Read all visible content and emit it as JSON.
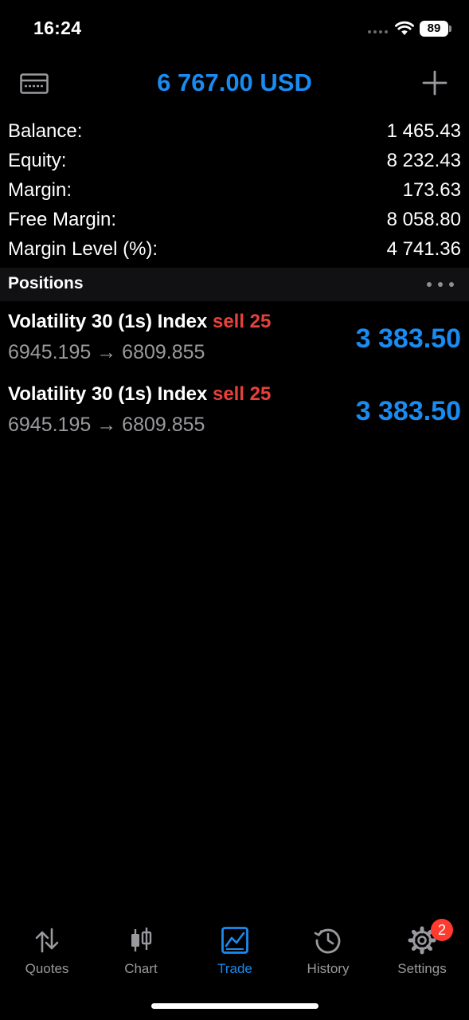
{
  "status_bar": {
    "time": "16:24",
    "battery": "89"
  },
  "header": {
    "title": "6 767.00 USD"
  },
  "account": [
    {
      "label": "Balance:",
      "value": "1 465.43"
    },
    {
      "label": "Equity:",
      "value": "8 232.43"
    },
    {
      "label": "Margin:",
      "value": "173.63"
    },
    {
      "label": "Free Margin:",
      "value": "8 058.80"
    },
    {
      "label": "Margin Level (%):",
      "value": "4 741.36"
    }
  ],
  "positions": {
    "title": "Positions",
    "items": [
      {
        "symbol": "Volatility 30 (1s) Index",
        "side": "sell 25",
        "prices": "6945.195 → 6809.855",
        "profit": "3 383.50"
      },
      {
        "symbol": "Volatility 30 (1s) Index",
        "side": "sell 25",
        "prices": "6945.195 → 6809.855",
        "profit": "3 383.50"
      }
    ]
  },
  "tabs": [
    {
      "label": "Quotes",
      "icon": "quotes-arrows-icon"
    },
    {
      "label": "Chart",
      "icon": "candlestick-icon"
    },
    {
      "label": "Trade",
      "icon": "trade-chart-icon",
      "active": true
    },
    {
      "label": "History",
      "icon": "history-clock-icon"
    },
    {
      "label": "Settings",
      "icon": "gear-icon",
      "badge": "2"
    }
  ],
  "colors": {
    "accent": "#1a8bf0",
    "sell": "#e8413c",
    "badge": "#ff3b30"
  }
}
